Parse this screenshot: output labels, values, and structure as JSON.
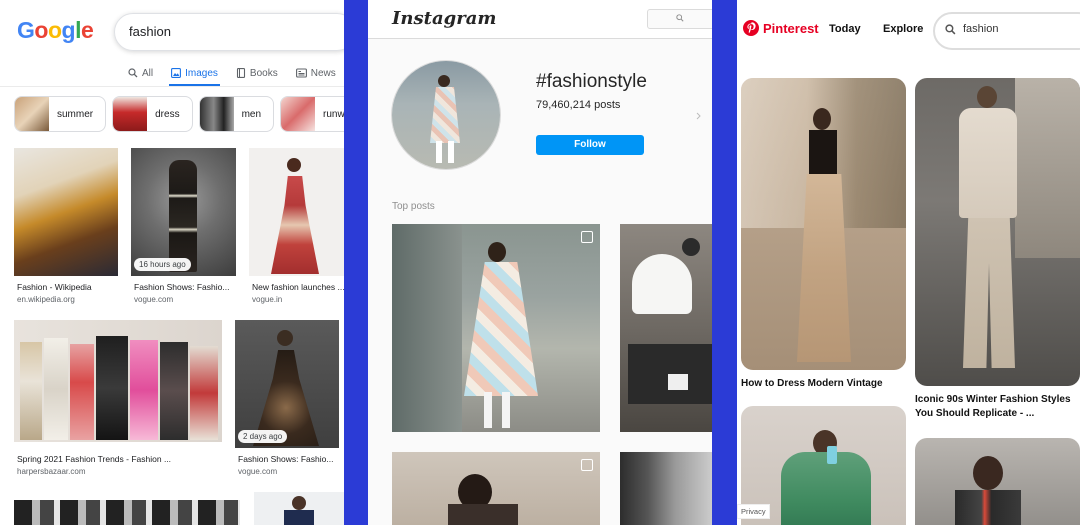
{
  "google": {
    "logo_letters": [
      {
        "ch": "G",
        "color": "#4285f4"
      },
      {
        "ch": "o",
        "color": "#ea4335"
      },
      {
        "ch": "o",
        "color": "#fbbc05"
      },
      {
        "ch": "g",
        "color": "#4285f4"
      },
      {
        "ch": "l",
        "color": "#34a853"
      },
      {
        "ch": "e",
        "color": "#ea4335"
      }
    ],
    "search_value": "fashion",
    "tabs": [
      {
        "label": "All",
        "icon": "search-icon",
        "active": false
      },
      {
        "label": "Images",
        "icon": "image-icon",
        "active": true
      },
      {
        "label": "Books",
        "icon": "book-icon",
        "active": false
      },
      {
        "label": "News",
        "icon": "news-icon",
        "active": false
      }
    ],
    "chips": [
      "summer",
      "dress",
      "men",
      "runwa"
    ],
    "results": [
      {
        "caption": "Fashion - Wikipedia",
        "source": "en.wikipedia.org",
        "badge": ""
      },
      {
        "caption": "Fashion Shows: Fashio...",
        "source": "vogue.com",
        "badge": "16 hours ago"
      },
      {
        "caption": "New fashion launches ...",
        "source": "vogue.in",
        "badge": ""
      },
      {
        "caption": "Spring 2021 Fashion Trends - Fashion ...",
        "source": "harpersbazaar.com",
        "badge": ""
      },
      {
        "caption": "Fashion Shows: Fashio...",
        "source": "vogue.com",
        "badge": "2 days ago"
      }
    ]
  },
  "instagram": {
    "logo": "Instagram",
    "hashtag": "#fashionstyle",
    "posts_count": "79,460,214 posts",
    "follow_label": "Follow",
    "top_posts_label": "Top posts"
  },
  "pinterest": {
    "logo": "Pinterest",
    "nav": [
      "Today",
      "Explore"
    ],
    "search_value": "fashion",
    "pins": [
      {
        "caption": "How to Dress Modern Vintage"
      },
      {
        "caption": "Iconic 90s Winter Fashion Styles You Should Replicate - ..."
      }
    ],
    "privacy_label": "Privacy"
  },
  "colors": {
    "divider_blue": "#2b3bd6",
    "google_blue": "#1a73e8",
    "ig_blue": "#0095f6",
    "pinterest_red": "#e60023"
  }
}
